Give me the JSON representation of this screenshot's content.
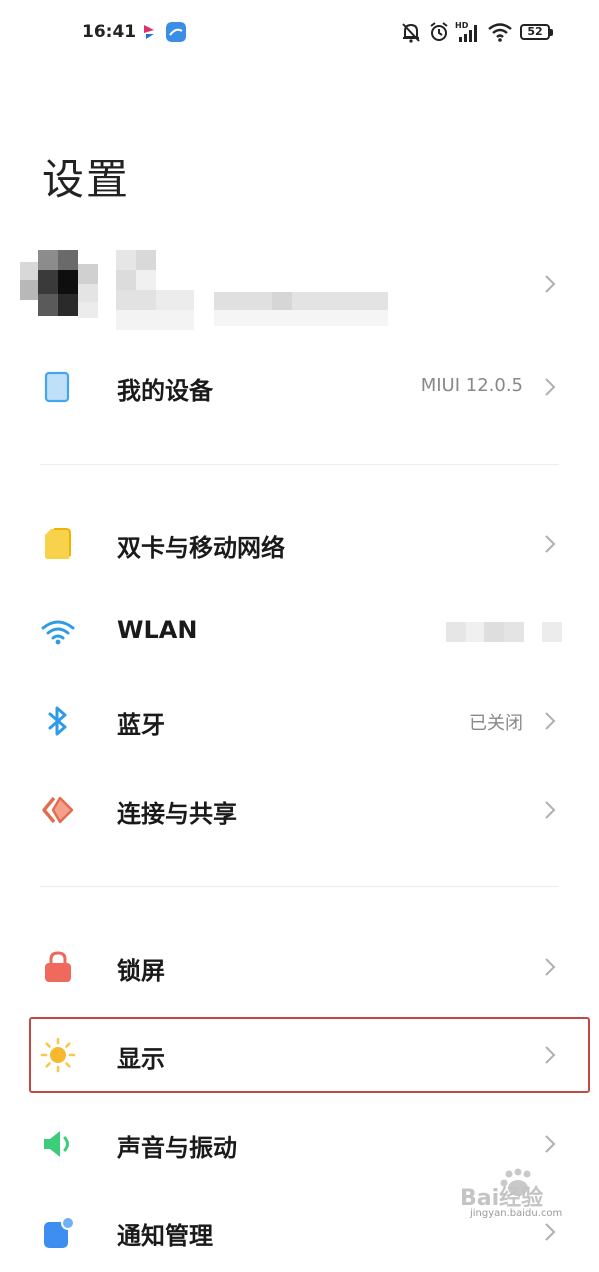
{
  "status_bar": {
    "time": "16:41",
    "battery": "52",
    "icons": [
      "app-icon-a",
      "app-icon-b",
      "mute-bell-icon",
      "alarm-icon",
      "hd-signal-icon",
      "wifi-icon",
      "battery-icon"
    ]
  },
  "title": "设置",
  "profile": {
    "avatar": "pixelated-avatar",
    "name": "pixelated"
  },
  "items": [
    {
      "label": "我的设备",
      "value": "MIUI 12.0.5",
      "icon": "tablet-icon",
      "color": "#43a6e8"
    },
    {
      "label": "双卡与移动网络",
      "value": "",
      "icon": "sim-card-icon",
      "color": "#f4c430"
    },
    {
      "label": "WLAN",
      "value": "",
      "icon": "wifi-icon",
      "color": "#2f9be8"
    },
    {
      "label": "蓝牙",
      "value": "已关闭",
      "icon": "bluetooth-icon",
      "color": "#2f9be8"
    },
    {
      "label": "连接与共享",
      "value": "",
      "icon": "share-icon",
      "color": "#e56b50"
    },
    {
      "label": "锁屏",
      "value": "",
      "icon": "lock-icon",
      "color": "#ef6a5d"
    },
    {
      "label": "显示",
      "value": "",
      "icon": "sun-icon",
      "color": "#f5b82e"
    },
    {
      "label": "声音与振动",
      "value": "",
      "icon": "speaker-icon",
      "color": "#3dcc7a"
    },
    {
      "label": "通知管理",
      "value": "",
      "icon": "notification-icon",
      "color": "#3d8ef0"
    }
  ],
  "watermark": {
    "text": "Bai经验",
    "url": "jingyan.baidu.com"
  }
}
